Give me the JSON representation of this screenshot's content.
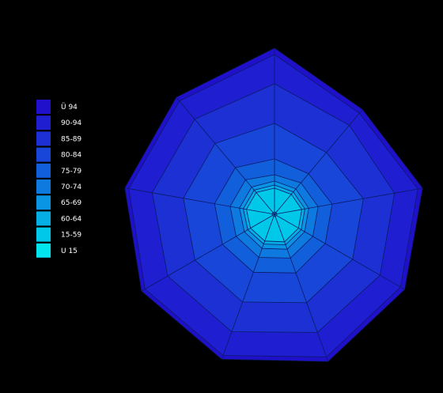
{
  "chart_data": {
    "type": "area",
    "subtype": "stacked-radar",
    "title": "",
    "axes_count": 9,
    "series": [
      {
        "name": "U 15",
        "color": "#00e5ee",
        "values": [
          3,
          3,
          3,
          3,
          3,
          3,
          3,
          3,
          3
        ]
      },
      {
        "name": "15-59",
        "color": "#00c8e8",
        "values": [
          30,
          30,
          32,
          32,
          34,
          33,
          32,
          33,
          33
        ]
      },
      {
        "name": "60-64",
        "color": "#06aee6",
        "values": [
          4,
          4,
          4,
          4,
          4,
          4,
          4,
          4,
          4
        ]
      },
      {
        "name": "65-69",
        "color": "#0a94e4",
        "values": [
          5,
          5,
          5,
          5,
          6,
          6,
          5,
          5,
          5
        ]
      },
      {
        "name": "70-74",
        "color": "#0e7ae0",
        "values": [
          8,
          10,
          12,
          12,
          12,
          12,
          12,
          12,
          12
        ]
      },
      {
        "name": "75-79",
        "color": "#125fdc",
        "values": [
          20,
          15,
          18,
          18,
          20,
          20,
          20,
          20,
          20
        ]
      },
      {
        "name": "80-84",
        "color": "#1846d8",
        "values": [
          45,
          35,
          40,
          40,
          40,
          40,
          40,
          40,
          40
        ]
      },
      {
        "name": "85-89",
        "color": "#1c30d4",
        "values": [
          50,
          45,
          40,
          40,
          40,
          40,
          40,
          40,
          40
        ]
      },
      {
        "name": "90-94",
        "color": "#1f1ed0",
        "values": [
          37,
          20,
          30,
          30,
          33,
          32,
          33,
          30,
          30
        ]
      },
      {
        "name": "Ü 94",
        "color": "#2010cc",
        "values": [
          8,
          6,
          6,
          6,
          6,
          5,
          5,
          5,
          6
        ]
      }
    ]
  }
}
